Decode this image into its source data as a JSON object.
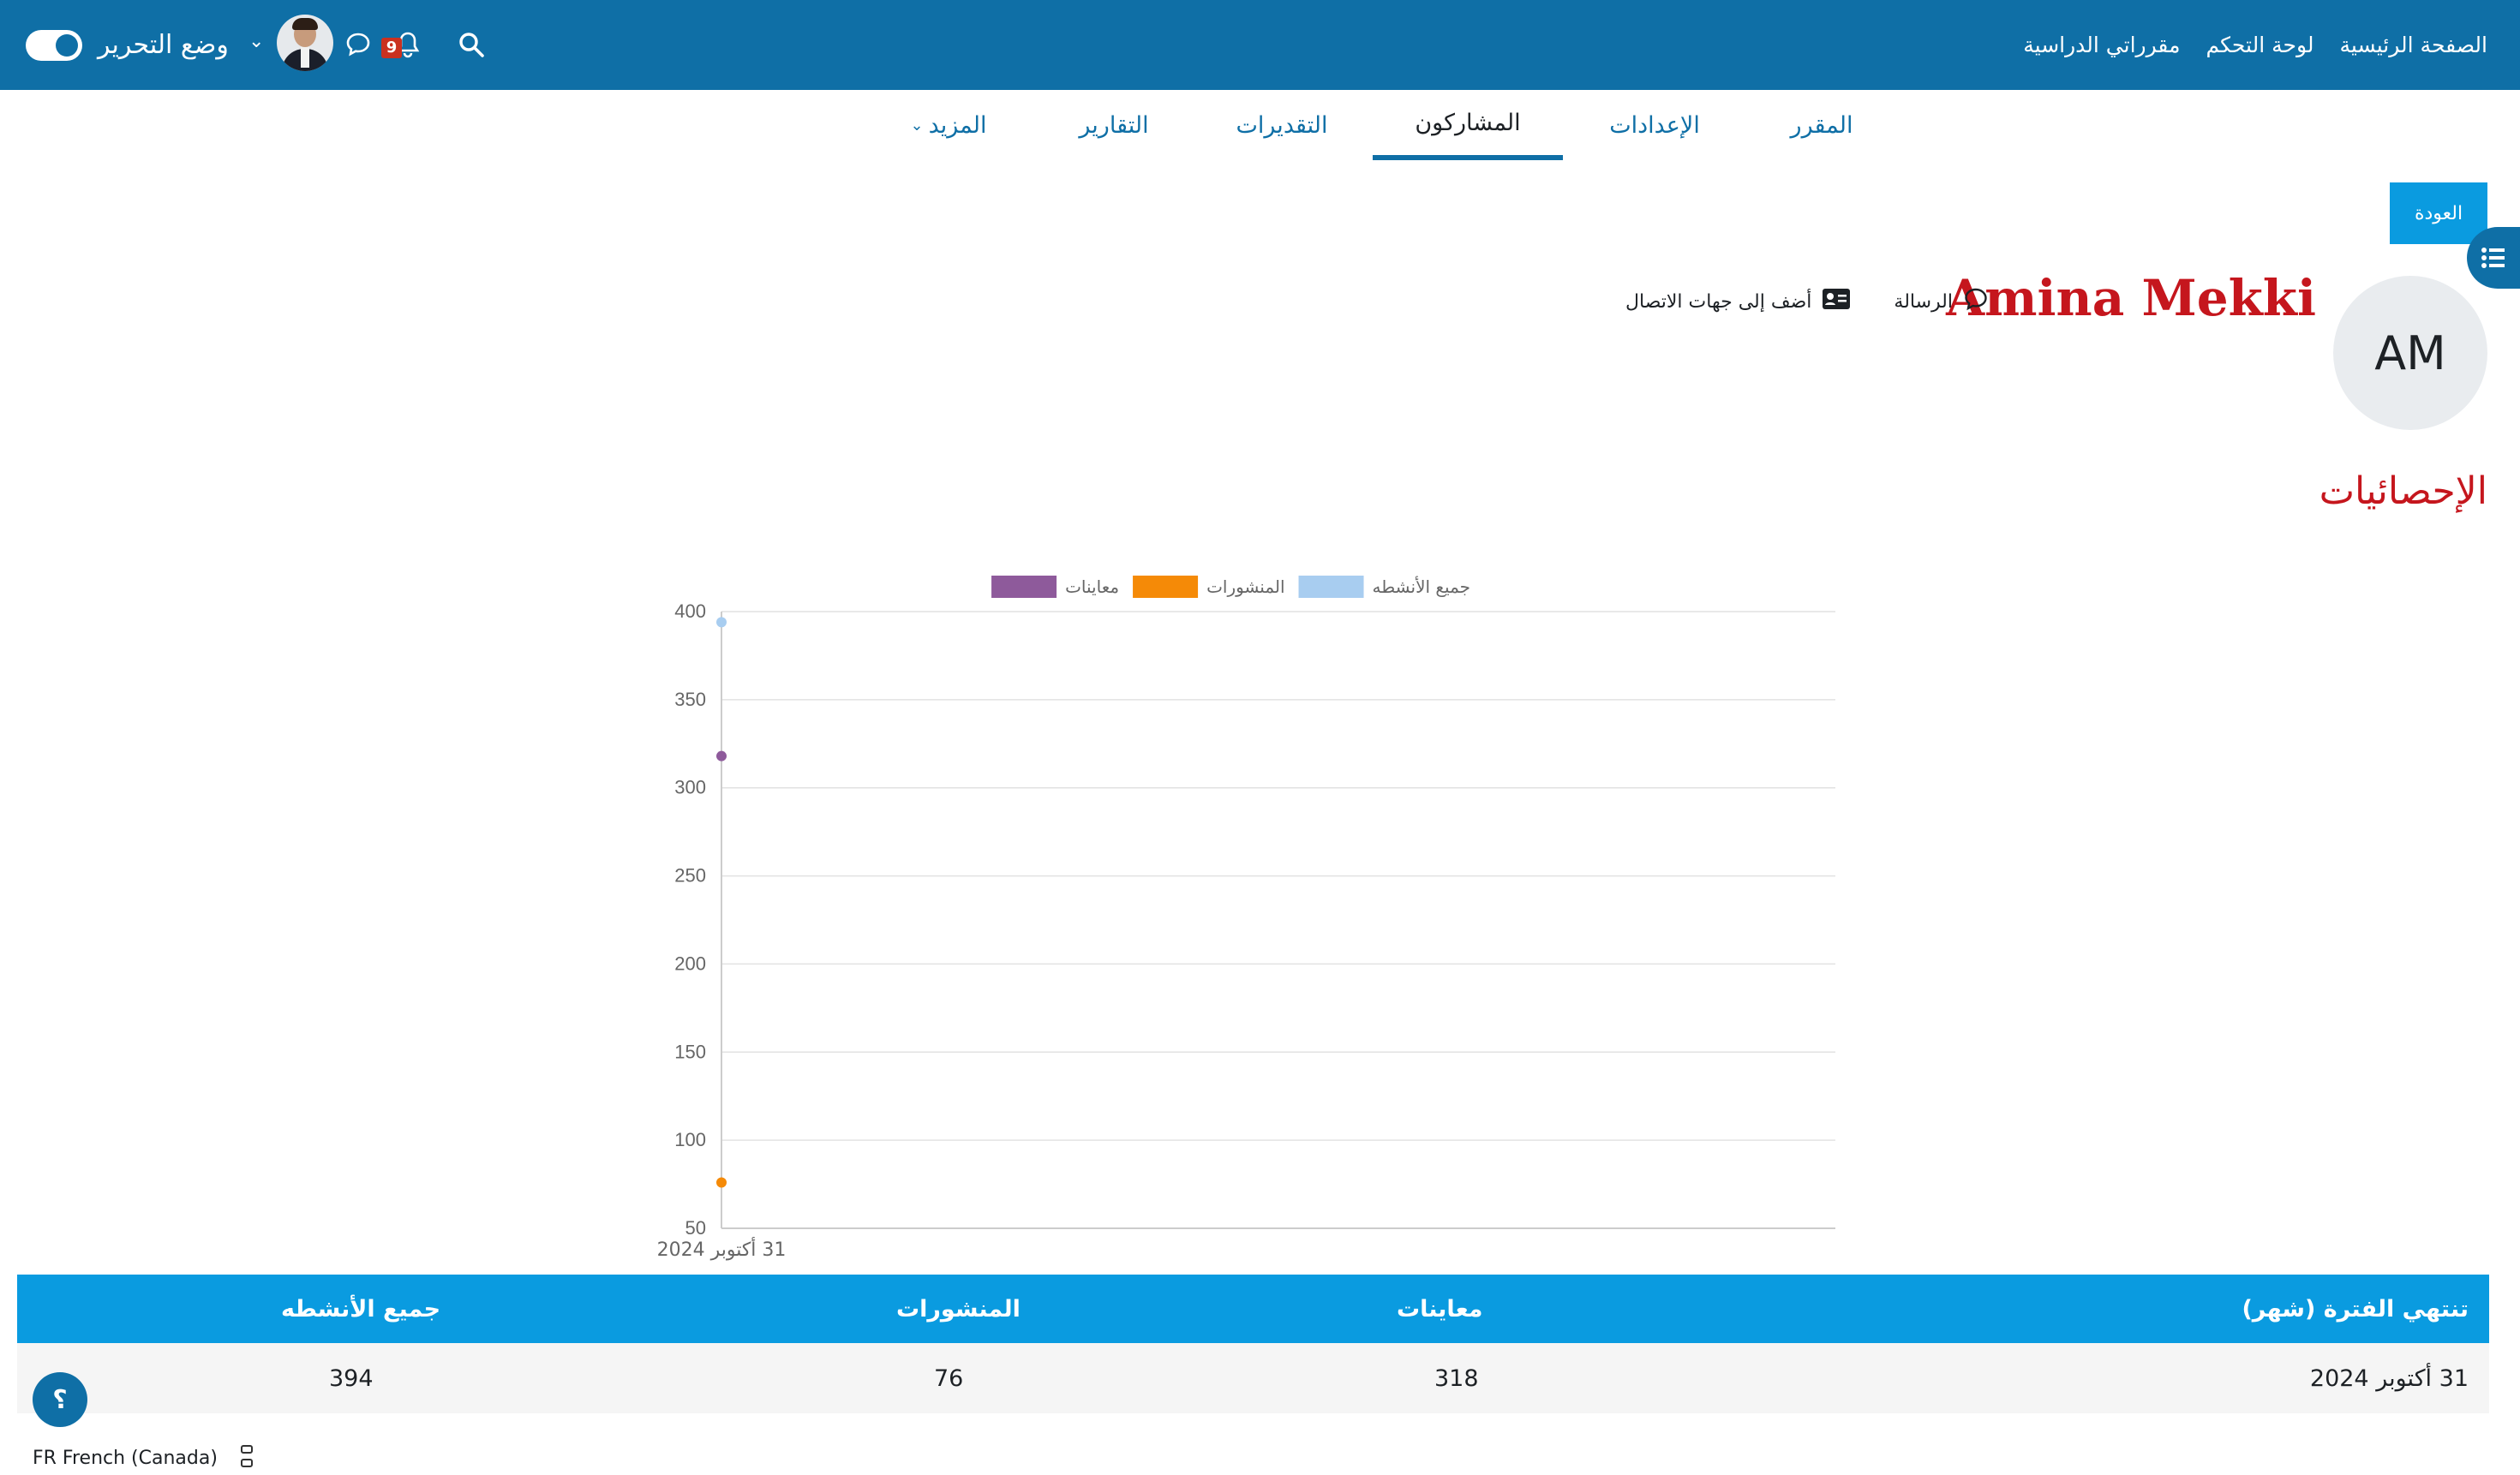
{
  "topbar": {
    "nav": [
      "الصفحة الرئيسية",
      "لوحة التحكم",
      "مقرراتي الدراسية"
    ],
    "edit_mode_label": "وضع التحرير",
    "notification_count": "9",
    "colors": {
      "bar": "#0f6fa6"
    }
  },
  "course_nav": {
    "tabs": [
      "المقرر",
      "الإعدادات",
      "المشاركون",
      "التقديرات",
      "التقارير",
      "المزيد"
    ],
    "active": "المشاركون"
  },
  "page": {
    "back_button": "العودة",
    "user": {
      "initials": "AM",
      "name": "Amina Mekki",
      "message_label": "الرسالة",
      "add_contact_label": "أضف إلى جهات الاتصال"
    },
    "section_title": "الإحصائيات"
  },
  "chart_data": {
    "type": "scatter",
    "x": [
      "31 أكتوبر 2024"
    ],
    "series": [
      {
        "name": "جميع الأنشطه",
        "values": [
          394
        ],
        "color": "#a8cdf0"
      },
      {
        "name": "المنشورات",
        "values": [
          76
        ],
        "color": "#f58a07"
      },
      {
        "name": "معاينات",
        "values": [
          318
        ],
        "color": "#8e5a9b"
      }
    ],
    "ylim": [
      50,
      400
    ],
    "yticks": [
      50,
      100,
      150,
      200,
      250,
      300,
      350,
      400
    ],
    "grid": true,
    "legend": "top"
  },
  "table": {
    "headers": [
      "تنتهي الفترة (شهر)",
      "معاينات",
      "المنشورات",
      "جميع الأنشطه"
    ],
    "rows": [
      [
        "31 أكتوبر 2024",
        "318",
        "76",
        "394"
      ]
    ]
  },
  "footer": {
    "help_label": "؟",
    "language": "FR French (Canada)"
  }
}
